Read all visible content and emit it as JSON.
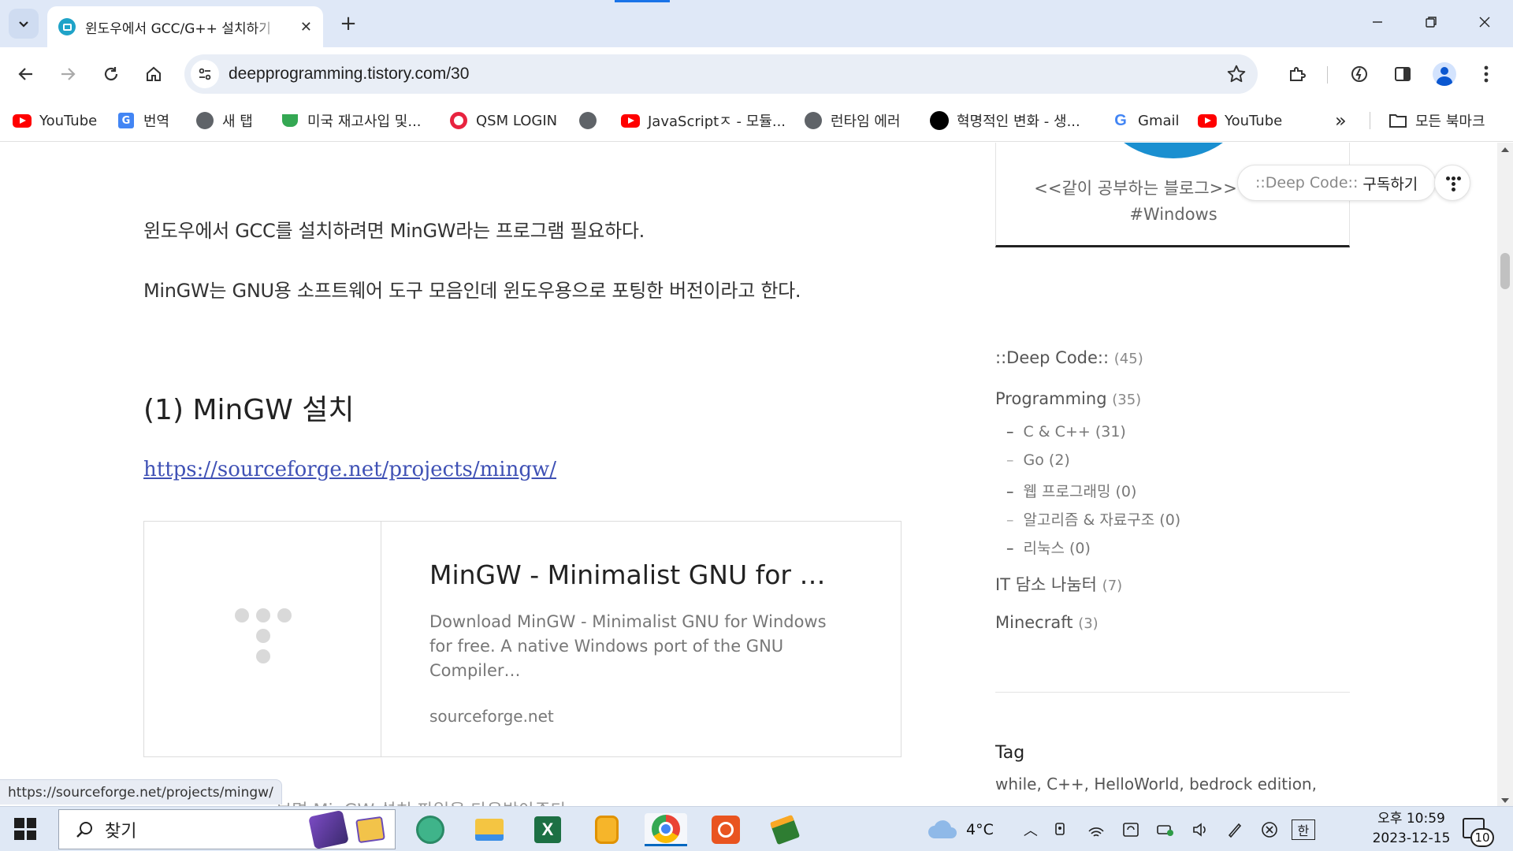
{
  "browser": {
    "tab_title": "윈도우에서 GCC/G++ 설치하기",
    "url": "deepprogramming.tistory.com/30",
    "new_tab_symbol": "+"
  },
  "bookmarks": [
    {
      "label": "YouTube",
      "icon": "youtube-icon"
    },
    {
      "label": "번역",
      "icon": "translate-icon"
    },
    {
      "label": "새 탭",
      "icon": "globe-icon"
    },
    {
      "label": "미국 재고사입 및...",
      "icon": "cup-icon"
    },
    {
      "label": "QSM LOGIN",
      "icon": "qsm-icon"
    },
    {
      "label": "",
      "icon": "globe-icon"
    },
    {
      "label": "JavaScriptㅈ - 모듈...",
      "icon": "youtube-icon"
    },
    {
      "label": "런타임 에러",
      "icon": "globe-icon"
    },
    {
      "label": "혁명적인 변화 - 생...",
      "icon": "black-circle-icon"
    },
    {
      "label": "Gmail",
      "icon": "google-icon"
    },
    {
      "label": "YouTube",
      "icon": "youtube-icon"
    }
  ],
  "bookmarks_more": "»",
  "all_bookmarks": "모든 북마크",
  "post": {
    "para1": "윈도우에서 GCC를 설치하려면 MinGW라는 프로그램 필요하다.",
    "para2": "MinGW는 GNU용 소프트웨어 도구 모음인데 윈도우용으로 포팅한 버전이라고 한다.",
    "heading": "(1) MinGW 설치",
    "link": "https://sourceforge.net/projects/mingw/",
    "card": {
      "title": "MinGW - Minimalist GNU for Windows",
      "description": "Download MinGW - Minimalist GNU for Windows for free. A native Windows port of the GNU Compiler…",
      "domain": "sourceforge.net"
    },
    "partial_text": "보면 MinGW 설치 파일을 다운받아준다"
  },
  "sidebar": {
    "profile_desc_line1": "<<같이 공부하는 블로그>> #C/C++",
    "profile_desc_line2": "#Windows",
    "subscribe_name": "::Deep Code::",
    "subscribe_label": "구독하기",
    "categories": [
      {
        "label": "::Deep Code::",
        "count": "(45)"
      },
      {
        "label": "Programming",
        "count": "(35)"
      }
    ],
    "subcategories": [
      {
        "label": "C & C++",
        "count": "(31)"
      },
      {
        "label": "Go",
        "count": "(2)"
      },
      {
        "label": "웹 프로그래밍",
        "count": "(0)"
      },
      {
        "label": "알고리즘 & 자료구조",
        "count": "(0)"
      },
      {
        "label": "리눅스",
        "count": "(0)"
      }
    ],
    "categories2": [
      {
        "label": "IT 담소 나눔터",
        "count": "(7)"
      },
      {
        "label": "Minecraft",
        "count": "(3)"
      }
    ],
    "tag_title": "Tag",
    "tags": "while,  C++,  HelloWorld,  bedrock edition,"
  },
  "status_url": "https://sourceforge.net/projects/mingw/",
  "taskbar": {
    "search_label": "찾기",
    "weather": "4°C",
    "ime": "한",
    "time": "오후 10:59",
    "date": "2023-12-15",
    "notification_count": "10"
  }
}
